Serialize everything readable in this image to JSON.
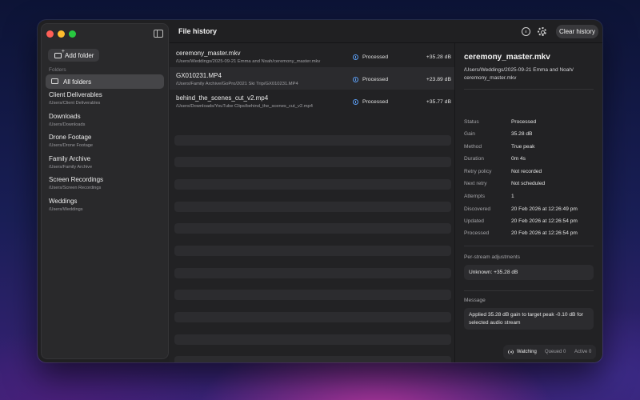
{
  "window": {
    "title": "File history"
  },
  "toolbar": {
    "clear_history_label": "Clear history",
    "filter_icon": "filter-icon",
    "settings_icon": "gear-icon"
  },
  "sidebar": {
    "add_folder_label": "Add folder",
    "section_label": "Folders",
    "all_folders_label": "All folders",
    "folders": [
      {
        "name": "Client Deliverables",
        "path": "/Users/Client Deliverables"
      },
      {
        "name": "Downloads",
        "path": "/Users/Downloads"
      },
      {
        "name": "Drone Footage",
        "path": "/Users/Drone Footage"
      },
      {
        "name": "Family Archive",
        "path": "/Users/Family Archive"
      },
      {
        "name": "Screen Recordings",
        "path": "/Users/Screen Recordings"
      },
      {
        "name": "Weddings",
        "path": "/Users/Weddings"
      }
    ]
  },
  "files": [
    {
      "name": "ceremony_master.mkv",
      "path": "/Users/Weddings/2025-09-21 Emma and Noah/ceremony_master.mkv",
      "status": "Processed",
      "gain": "+35.28 dB"
    },
    {
      "name": "GX010231.MP4",
      "path": "/Users/Family Archive/GoPro/2021 Ski Trip/GX010231.MP4",
      "status": "Processed",
      "gain": "+23.89 dB"
    },
    {
      "name": "behind_the_scenes_cut_v2.mp4",
      "path": "/Users/Downloads/YouTube Clips/behind_the_scenes_cut_v2.mp4",
      "status": "Processed",
      "gain": "+35.77 dB"
    }
  ],
  "detail": {
    "title": "ceremony_master.mkv",
    "path": "/Users/Weddings/2025-09-21 Emma and Noah/ ceremony_master.mkv",
    "fields": [
      {
        "label": "Status",
        "value": "Processed"
      },
      {
        "label": "Gain",
        "value": "35.28 dB"
      },
      {
        "label": "Method",
        "value": "True peak"
      },
      {
        "label": "Duration",
        "value": "0m 4s"
      },
      {
        "label": "Retry policy",
        "value": "Not recorded"
      },
      {
        "label": "Next retry",
        "value": "Not scheduled"
      },
      {
        "label": "Attempts",
        "value": "1"
      },
      {
        "label": "Discovered",
        "value": "20 Feb 2026 at 12:26:49 pm"
      },
      {
        "label": "Updated",
        "value": "20 Feb 2026 at 12:26:54 pm"
      },
      {
        "label": "Processed",
        "value": "20 Feb 2026 at 12:26:54 pm"
      }
    ],
    "per_stream_label": "Per-stream adjustments",
    "per_stream_value": "Unknown: +35.28 dB",
    "message_label": "Message",
    "message_value": "Applied 35.28 dB gain to target peak -0.10 dB for selected audio stream"
  },
  "footer": {
    "watch_status": "Watching",
    "queued": "Queued 0",
    "active": "Active 0"
  }
}
